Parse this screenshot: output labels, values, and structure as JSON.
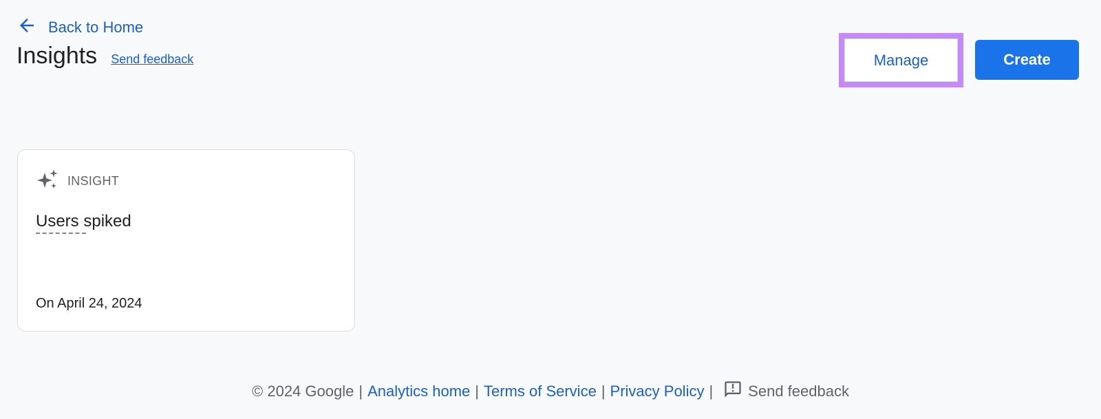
{
  "header": {
    "back_label": "Back to Home",
    "page_title": "Insights",
    "feedback_label": "Send feedback"
  },
  "actions": {
    "manage_label": "Manage",
    "create_label": "Create"
  },
  "insight_card": {
    "kicker": "INSIGHT",
    "title": "Users spiked",
    "date": "On April 24, 2024",
    "icon": "sparkle-icon"
  },
  "footer": {
    "copyright": "© 2024 Google",
    "links": [
      "Analytics home",
      "Terms of Service",
      "Privacy Policy"
    ],
    "feedback_label": "Send feedback",
    "feedback_icon": "feedback-icon"
  },
  "colors": {
    "link": "#1a5fd0",
    "primary": "#1a73e8",
    "highlight": "#c58af9",
    "background": "#f8f9fa"
  }
}
